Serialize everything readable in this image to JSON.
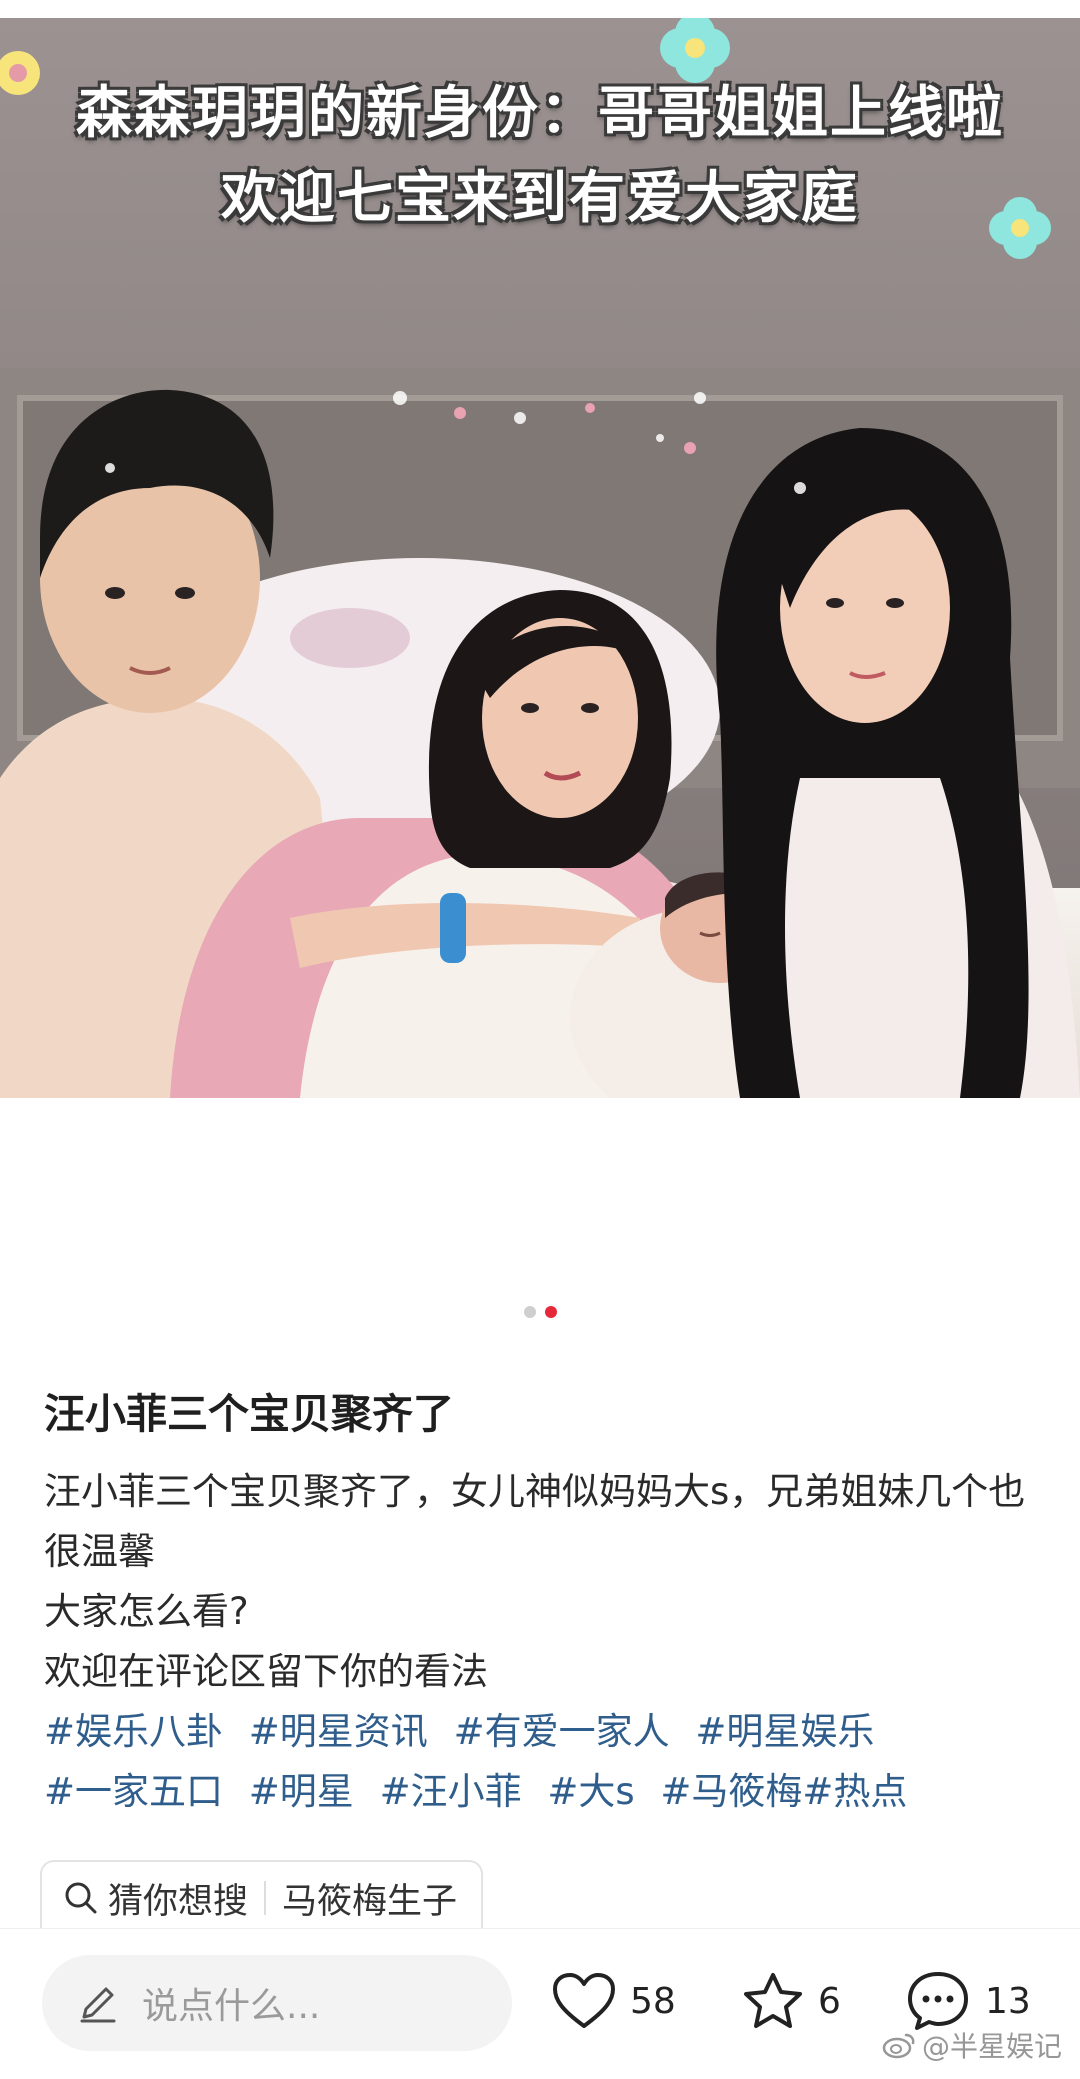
{
  "photo": {
    "caption_line1": "森森玥玥的新身份：哥哥姐姐上线啦",
    "caption_line2": "欢迎七宝来到有爱大家庭"
  },
  "pager": {
    "total": 2,
    "active_index": 1
  },
  "post": {
    "title": "汪小菲三个宝贝聚齐了",
    "body": [
      "汪小菲三个宝贝聚齐了，女儿神似妈妈大s，兄弟姐妹几个也很温馨",
      "大家怎么看?",
      "欢迎在评论区留下你的看法"
    ],
    "tags": [
      "#娱乐八卦",
      "#明星资讯",
      "#有爱一家人",
      "#明星娱乐",
      "#一家五口",
      "#明星",
      "#汪小菲",
      "#大s",
      "#马筱梅",
      "#热点"
    ]
  },
  "search_chip": {
    "label": "猜你想搜",
    "suggestion": "马筱梅生子",
    "icon": "search-icon"
  },
  "bottom_bar": {
    "comment_placeholder": "说点什么...",
    "likes": "58",
    "favorites": "6",
    "comments": "13"
  },
  "watermark": {
    "text": "@半星娱记",
    "icon": "weibo-icon"
  },
  "colors": {
    "accent_red": "#e5293b",
    "tag_blue": "#2f5d8c",
    "dot_inactive": "#cfcfcf"
  }
}
